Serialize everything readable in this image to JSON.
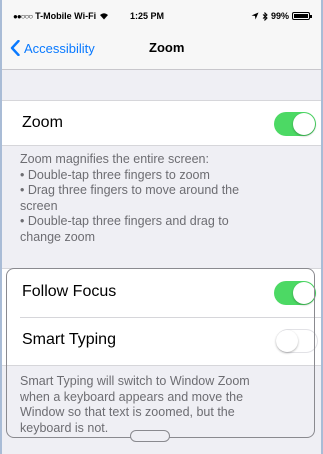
{
  "status_bar": {
    "signal": "●●○○○",
    "carrier": "T-Mobile Wi-Fi",
    "time": "1:25 PM",
    "battery": "99%"
  },
  "nav": {
    "back_label": "Accessibility",
    "title": "Zoom"
  },
  "zoom_cell": {
    "label": "Zoom",
    "toggle_on": true
  },
  "zoom_footer": [
    "Zoom magnifies the entire screen:",
    "• Double-tap three fingers to zoom",
    "• Drag three fingers to move around the",
    "screen",
    "• Double-tap three fingers and drag to",
    "change zoom"
  ],
  "follow_focus": {
    "label": "Follow Focus",
    "toggle_on": true
  },
  "smart_typing": {
    "label": "Smart Typing",
    "toggle_on": false
  },
  "smart_typing_footer": [
    "Smart Typing will switch to Window Zoom",
    "when a keyboard appears and move the",
    "Window so that text is zoomed, but the",
    "keyboard is not."
  ],
  "colors": {
    "accent": "#0a7aff",
    "toggle_on": "#4cd964",
    "background": "#efeff4"
  }
}
